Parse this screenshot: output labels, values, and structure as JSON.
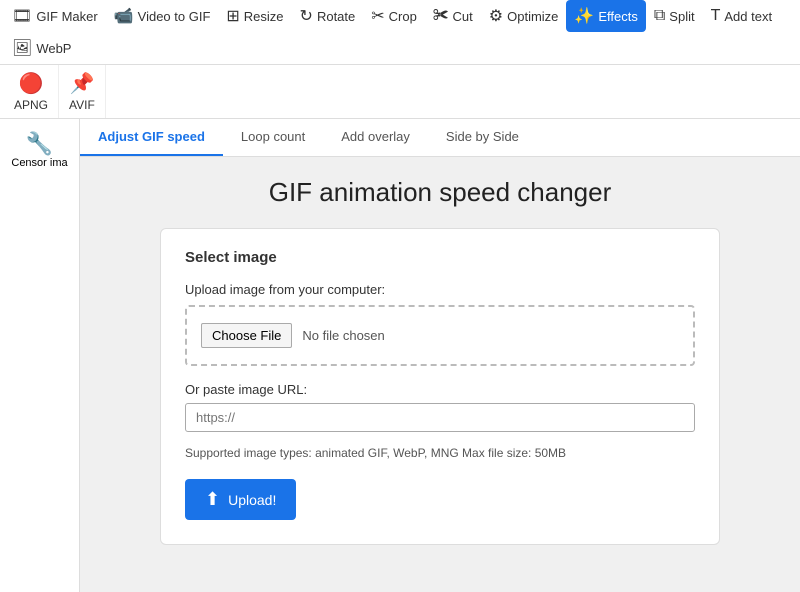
{
  "topNav": {
    "items": [
      {
        "id": "gif-maker",
        "label": "GIF Maker",
        "icon": "🎞",
        "active": false
      },
      {
        "id": "video-to-gif",
        "label": "Video to GIF",
        "icon": "📹",
        "active": false
      },
      {
        "id": "resize",
        "label": "Resize",
        "icon": "⊞",
        "active": false
      },
      {
        "id": "rotate",
        "label": "Rotate",
        "icon": "↻",
        "active": false
      },
      {
        "id": "crop",
        "label": "Crop",
        "icon": "✂",
        "active": false
      },
      {
        "id": "cut",
        "label": "Cut",
        "icon": "✀",
        "active": false
      },
      {
        "id": "optimize",
        "label": "Optimize",
        "icon": "⚙",
        "active": false
      },
      {
        "id": "effects",
        "label": "Effects",
        "icon": "✨",
        "active": true
      },
      {
        "id": "split",
        "label": "Split",
        "icon": "⧉",
        "active": false
      },
      {
        "id": "add-text",
        "label": "Add text",
        "icon": "T",
        "active": false
      },
      {
        "id": "webp",
        "label": "WebP",
        "icon": "🖼",
        "active": false
      }
    ]
  },
  "secondNav": {
    "items": [
      {
        "id": "apng",
        "label": "APNG",
        "icon": "🔴"
      },
      {
        "id": "avif",
        "label": "AVIF",
        "icon": "📌"
      }
    ]
  },
  "sidePanel": {
    "item": {
      "icon": "🔧",
      "label": "Censor ima"
    }
  },
  "tabs": {
    "items": [
      {
        "id": "adjust-speed",
        "label": "Adjust GIF speed",
        "active": true
      },
      {
        "id": "loop-count",
        "label": "Loop count",
        "active": false
      },
      {
        "id": "add-overlay",
        "label": "Add overlay",
        "active": false
      },
      {
        "id": "side-by-side",
        "label": "Side by Side",
        "active": false
      }
    ]
  },
  "page": {
    "title": "GIF animation speed changer"
  },
  "card": {
    "title": "Select image",
    "uploadLabel": "Upload image from your computer:",
    "chooseFileBtn": "Choose File",
    "noFileText": "No file chosen",
    "urlLabel": "Or paste image URL:",
    "urlPlaceholder": "https://",
    "supportedText": "Supported image types: animated GIF, WebP, MNG\nMax file size: 50MB",
    "uploadBtn": "Upload!"
  }
}
